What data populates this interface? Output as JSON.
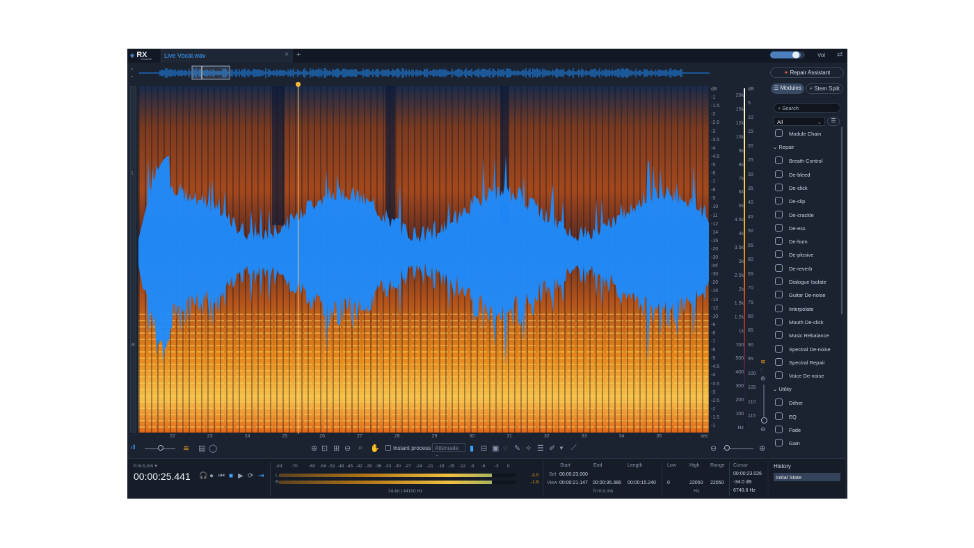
{
  "tab": {
    "title": "Live Vocal.wav"
  },
  "volume": {
    "label": "Vol",
    "level": 0.8
  },
  "channels": [
    "L",
    "R"
  ],
  "db_scale": [
    "dB",
    "-1",
    "-1.5",
    "-2",
    "-2.5",
    "-3",
    "-3.5",
    "-4",
    "-4.5",
    "-5",
    "-6",
    "-7",
    "-8",
    "-9",
    "-10",
    "-11",
    "-12",
    "-14",
    "-16",
    "-20",
    "-30",
    "-inf",
    "-30",
    "-20",
    "-16",
    "-14",
    "-12",
    "-10",
    "-9",
    "-8",
    "-7",
    "-6",
    "-5",
    "-4.5",
    "-4",
    "-3.5",
    "-3",
    "-2.5",
    "-2",
    "-1.5",
    "-1"
  ],
  "hz_scale": [
    "20k",
    "15k",
    "12k",
    "10k",
    "9k",
    "8k",
    "7k",
    "6k",
    "5k",
    "4.5k",
    "4k",
    "3.5k",
    "3k",
    "2.5k",
    "2k",
    "1.5k",
    "1.2k",
    "1k",
    "700",
    "500",
    "400",
    "300",
    "200",
    "100",
    "Hz"
  ],
  "color_scale": [
    "dB",
    "5",
    "10",
    "15",
    "20",
    "25",
    "30",
    "35",
    "40",
    "45",
    "50",
    "55",
    "60",
    "65",
    "70",
    "75",
    "80",
    "85",
    "90",
    "95",
    "100",
    "105",
    "110",
    "115"
  ],
  "time_axis": [
    "22",
    "23",
    "24",
    "25",
    "26",
    "27",
    "28",
    "29",
    "30",
    "31",
    "32",
    "33",
    "34",
    "35",
    "sec"
  ],
  "toolbar": {
    "instant_process": "Instant process",
    "attenuate": "Attenuate"
  },
  "transport": {
    "time_format": "h:m:s.ms",
    "timecode": "00:00:25.441"
  },
  "meter": {
    "scale": [
      "-Inf.",
      "-70",
      "-60",
      "-54",
      "-51",
      "-48",
      "-45",
      "-42",
      "-39",
      "-36",
      "-33",
      "-30",
      "-27",
      "-24",
      "-21",
      "-18",
      "-15",
      "-12",
      "-9",
      "-6",
      "-3",
      "0"
    ],
    "left_label": "L",
    "right_label": "R",
    "left_peak": "-2.0",
    "right_peak": "-1.9",
    "left_level": 0.9,
    "right_level": 0.9,
    "format": "24-bit | 44100 Hz"
  },
  "selection": {
    "headers": [
      "Start",
      "End",
      "Length"
    ],
    "sel_label": "Sel",
    "view_label": "View",
    "sel": [
      "00:00:23.000",
      "",
      ""
    ],
    "view": [
      "00:00:21.147",
      "00:00:36.386",
      "00:00:15.240"
    ],
    "unit": "h:m:s.ms"
  },
  "freq": {
    "headers": [
      "Low",
      "High",
      "Range"
    ],
    "values": [
      "0",
      "22050",
      "22050"
    ],
    "unit": "Hz"
  },
  "cursor": {
    "label": "Cursor",
    "time": "00:00:23.026",
    "db": "-34.0 dB",
    "hz": "6740.6 Hz"
  },
  "right_panel": {
    "repair_assistant": "Repair Assistant",
    "modules_tab": "Modules",
    "stem_tab": "Stem Split",
    "search_placeholder": "Search",
    "filter": "All",
    "module_chain": "Module Chain",
    "repair_title": "Repair",
    "repair": [
      "Breath Control",
      "De-bleed",
      "De-click",
      "De-clip",
      "De-crackle",
      "De-ess",
      "De-hum",
      "De-plosive",
      "De-reverb",
      "Dialogue Isolate",
      "Guitar De-noise",
      "Interpolate",
      "Mouth De-click",
      "Music Rebalance",
      "Spectral De-noise",
      "Spectral Repair",
      "Voice De-noise"
    ],
    "utility_title": "Utility",
    "utility": [
      "Dither",
      "EQ",
      "Fade",
      "Gain"
    ]
  },
  "history": {
    "title": "History",
    "items": [
      "Initial State"
    ]
  },
  "colors": {
    "accent": "#3ea0ff",
    "waveform": "#1e8cff",
    "spectrum_hot": "#f3a019",
    "playhead": "#f4b63a"
  }
}
